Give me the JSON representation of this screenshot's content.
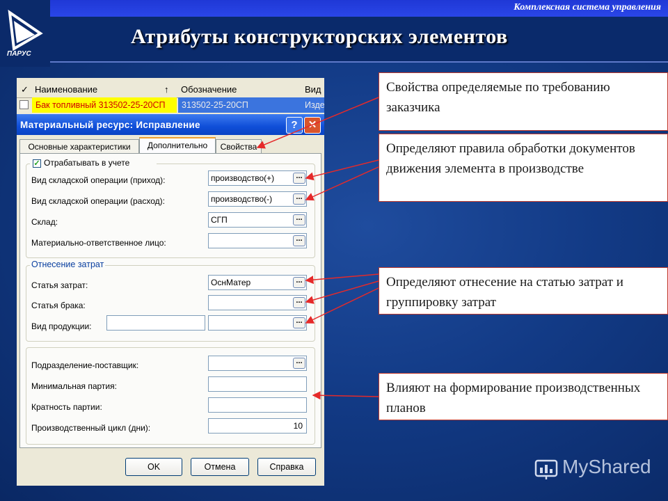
{
  "header": {
    "top_text": "Комплексная система управления",
    "title": "Атрибуты конструкторских элементов",
    "logo_text": "ПАРУС"
  },
  "grid": {
    "columns": [
      "Наименование",
      "Обозначение",
      "Вид"
    ],
    "row": {
      "name": "Бак топливный 313502-25-20СП",
      "code": "313502-25-20СП",
      "kind": "Изде"
    }
  },
  "dialog": {
    "title": "Материальный ресурс: Исправление",
    "help_glyph": "?",
    "close_glyph": "✕",
    "tabs": [
      "Основные характеристики",
      "Дополнительно",
      "Свойства"
    ],
    "active_tab": "Дополнительно",
    "group1": {
      "checkbox_label": "Отрабатывать в учете",
      "checked": true,
      "fields": [
        {
          "label": "Вид складской операции (приход):",
          "value": "производство(+)"
        },
        {
          "label": "Вид складской операции (расход):",
          "value": "производство(-)"
        },
        {
          "label": "Склад:",
          "value": "СГП"
        },
        {
          "label": "Материально-ответственное лицо:",
          "value": ""
        }
      ]
    },
    "group2": {
      "legend": "Отнесение затрат",
      "fields": [
        {
          "label": "Статья затрат:",
          "value": "ОснМатер"
        },
        {
          "label": "Статья брака:",
          "value": ""
        },
        {
          "label": "Вид продукции:",
          "value": ""
        }
      ]
    },
    "group3": {
      "fields": [
        {
          "label": "Подразделение-поставщик:",
          "value": ""
        },
        {
          "label": "Минимальная партия:",
          "value": ""
        },
        {
          "label": "Кратность партии:",
          "value": ""
        },
        {
          "label": "Производственный цикл (дни):",
          "value": "10"
        }
      ]
    },
    "buttons": {
      "ok": "OK",
      "cancel": "Отмена",
      "help": "Справка"
    }
  },
  "annotations": [
    "Свойства определяемые по требованию заказчика",
    "Определяют правила обработки документов движения элемента в производстве",
    "Определяют отнесение на статью затрат и группировку затрат",
    "Влияют на формирование производственных планов"
  ],
  "watermark": "MyShared",
  "colors": {
    "accent_red": "#c0392b",
    "background": "#123a85",
    "title_bar": "#0f4ed8"
  }
}
